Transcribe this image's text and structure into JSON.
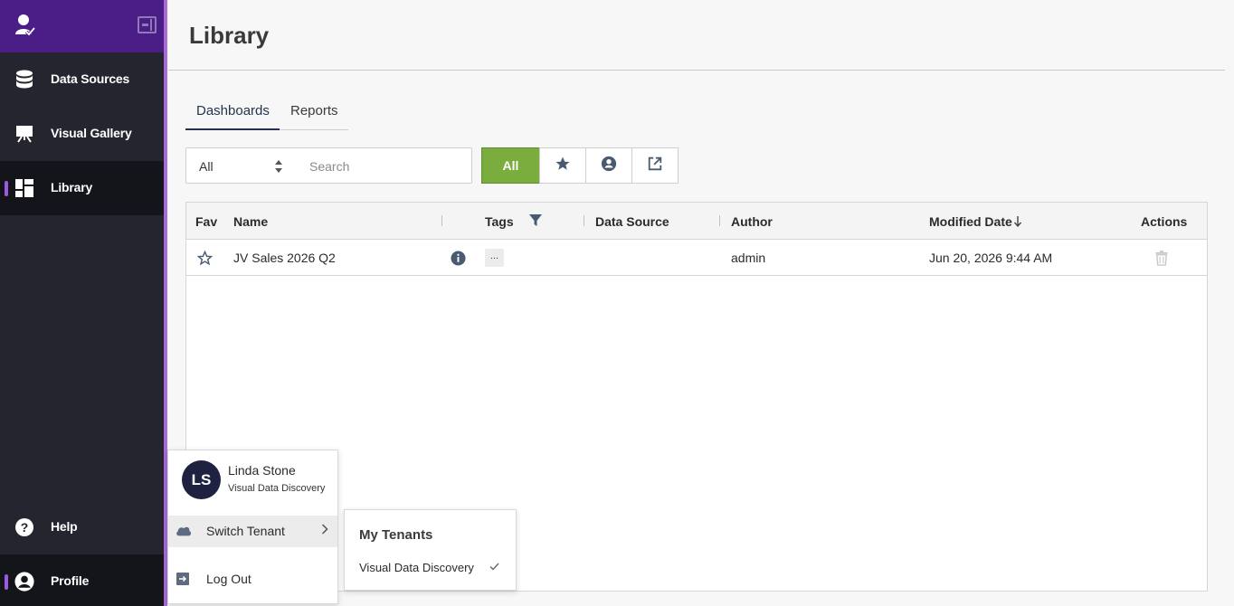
{
  "sidebar": {
    "items": [
      {
        "label": "Data Sources",
        "icon": "database-icon"
      },
      {
        "label": "Visual Gallery",
        "icon": "easel-icon"
      },
      {
        "label": "Library",
        "icon": "dashboard-icon",
        "active": true
      }
    ],
    "bottom": [
      {
        "label": "Help",
        "icon": "help-icon"
      },
      {
        "label": "Profile",
        "icon": "profile-icon",
        "active": true
      }
    ]
  },
  "header": {
    "title": "Library"
  },
  "tabs": [
    {
      "label": "Dashboards",
      "active": true
    },
    {
      "label": "Reports",
      "active": false
    }
  ],
  "filter": {
    "select_value": "All",
    "search_placeholder": "Search",
    "segments": [
      {
        "label": "All",
        "icon": "",
        "active": true
      },
      {
        "label": "",
        "icon": "star-icon"
      },
      {
        "label": "",
        "icon": "user-circle-icon"
      },
      {
        "label": "",
        "icon": "external-share-icon"
      }
    ]
  },
  "table": {
    "columns": [
      "Fav",
      "Name",
      "Tags",
      "Data Source",
      "Author",
      "Modified Date",
      "Actions"
    ],
    "sort": {
      "column": "Modified Date",
      "direction": "desc"
    },
    "rows": [
      {
        "fav": false,
        "name": "JV Sales 2026 Q2",
        "tags": "...",
        "data_source": "",
        "author": "admin",
        "modified": "Jun 20, 2026 9:44 AM"
      }
    ]
  },
  "profile_menu": {
    "initials": "LS",
    "name": "Linda Stone",
    "tenant": "Visual Data Discovery",
    "items": [
      {
        "label": "Switch Tenant",
        "icon": "cloud-icon"
      },
      {
        "label": "Log Out",
        "icon": "logout-icon"
      }
    ]
  },
  "tenant_menu": {
    "title": "My Tenants",
    "items": [
      {
        "label": "Visual Data Discovery",
        "selected": true
      }
    ]
  },
  "colors": {
    "sidebar_bg": "#25252f",
    "sidebar_header": "#4b1d87",
    "accent": "#a66bd6",
    "active_filter": "#7aad3e"
  }
}
